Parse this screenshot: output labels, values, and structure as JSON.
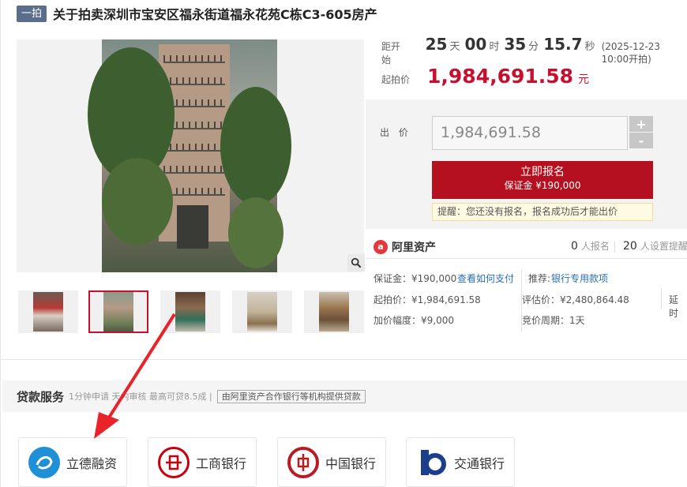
{
  "header": {
    "tag": "一拍",
    "title": "关于拍卖深圳市宝安区福永街道福永花苑C栋C3-605房产"
  },
  "countdown": {
    "label": "距开始",
    "days": "25",
    "days_unit": "天",
    "hours": "00",
    "hours_unit": "时",
    "minutes": "35",
    "minutes_unit": "分",
    "seconds": "15.7",
    "seconds_unit": "秒",
    "start_time": "(2025-12-23 10:00开拍)"
  },
  "start_price": {
    "label": "起拍价",
    "value": "1,984,691.58",
    "unit": "元"
  },
  "bid": {
    "label": "出 价",
    "input_value": "1,984,691.58",
    "plus": "+",
    "minus": "-",
    "apply_label": "立即报名",
    "deposit_label": "保证金 ¥190,000",
    "reminder": "提醒：您还没有报名，报名成功后才能出价"
  },
  "ali": {
    "logo_text": "阿里资产",
    "registered_count": "0",
    "registered_label": "人报名",
    "reminder_count": "20",
    "reminder_label": "人设置提醒"
  },
  "info": {
    "deposit": "保证金：¥190,000",
    "how_to_pay": "查看如何支付",
    "recommend_label": "推荐:",
    "bank_loan": "银行专用款项",
    "start_price": "起拍价：¥1,984,691.58",
    "appraisal": "评估价：¥2,480,864.48",
    "delay": "延时",
    "increment": "加价幅度：¥9,000",
    "cycle": "竞价周期：1天"
  },
  "loan": {
    "title": "贷款服务",
    "subtitle": "1分钟申请 天内审核 最高可贷8.5成 |",
    "provider": "由阿里资产合作银行等机构提供贷款"
  },
  "banks": [
    {
      "name": "立德融资",
      "icon": "lide-logo-icon",
      "color": "#1f8fd6"
    },
    {
      "name": "工商银行",
      "icon": "icbc-logo-icon",
      "color": "#c7000b"
    },
    {
      "name": "中国银行",
      "icon": "boc-logo-icon",
      "color": "#b81c22"
    },
    {
      "name": "交通银行",
      "icon": "bocom-logo-icon",
      "color": "#1b3f8a"
    }
  ],
  "colors": {
    "accent": "#c8102e",
    "link": "#2a6db5",
    "tag": "#5a6e8c"
  }
}
